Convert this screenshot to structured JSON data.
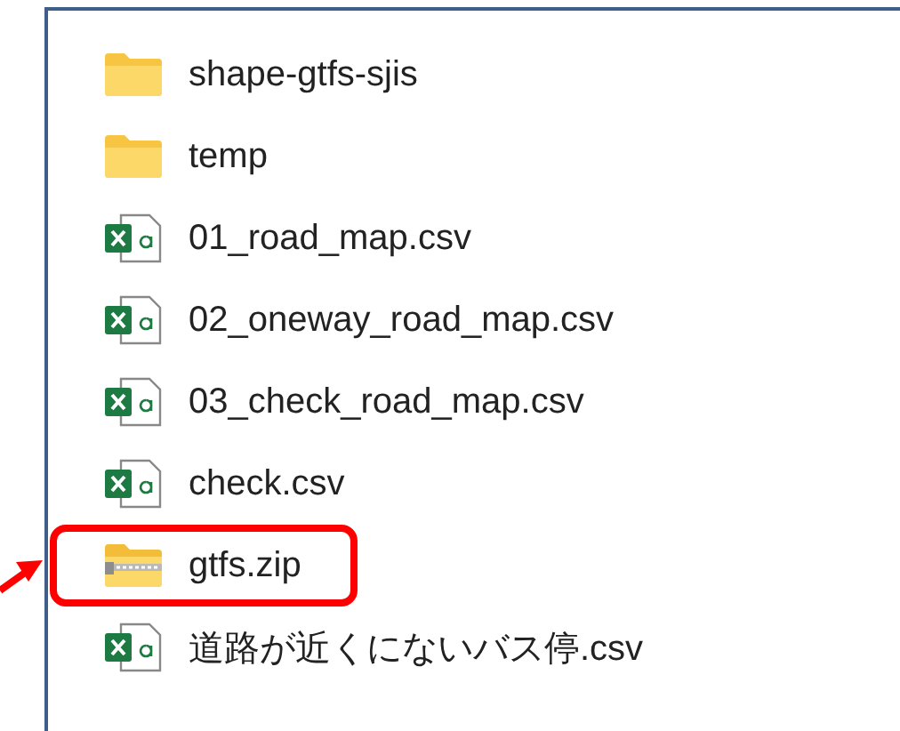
{
  "files": [
    {
      "name": "shape-gtfs-sjis",
      "kind": "folder",
      "highlighted": false
    },
    {
      "name": "temp",
      "kind": "folder",
      "highlighted": false
    },
    {
      "name": "01_road_map.csv",
      "kind": "csv",
      "highlighted": false
    },
    {
      "name": "02_oneway_road_map.csv",
      "kind": "csv",
      "highlighted": false
    },
    {
      "name": "03_check_road_map.csv",
      "kind": "csv",
      "highlighted": false
    },
    {
      "name": "check.csv",
      "kind": "csv",
      "highlighted": false
    },
    {
      "name": "gtfs.zip",
      "kind": "zip",
      "highlighted": true
    },
    {
      "name": "道路が近くにないバス停.csv",
      "kind": "csv",
      "highlighted": false
    }
  ]
}
